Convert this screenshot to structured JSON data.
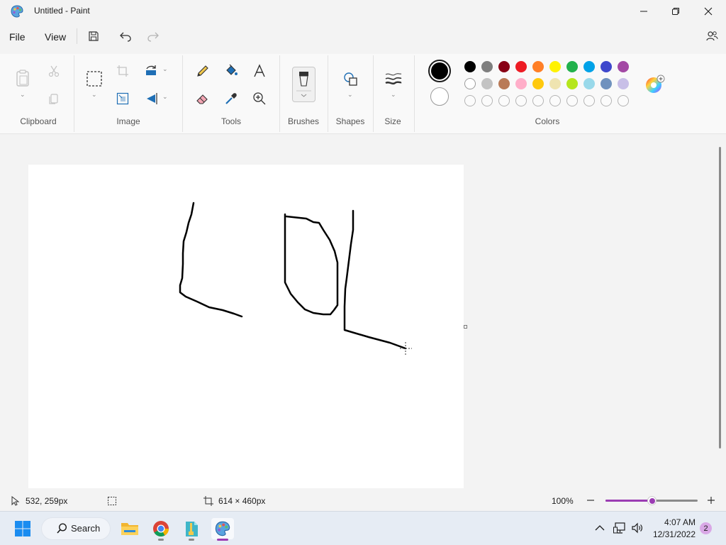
{
  "window": {
    "title": "Untitled - Paint"
  },
  "menu": {
    "file": "File",
    "view": "View"
  },
  "ribbon": {
    "groups": {
      "clipboard": "Clipboard",
      "image": "Image",
      "tools": "Tools",
      "brushes": "Brushes",
      "shapes": "Shapes",
      "size": "Size",
      "colors": "Colors"
    }
  },
  "colors": {
    "primary": "#000000",
    "secondary": "#ffffff",
    "palette_row1": [
      "#000000",
      "#7f7f7f",
      "#880015",
      "#ed1c24",
      "#ff7f27",
      "#fff200",
      "#22b14c",
      "#00a2e8",
      "#3f48cc",
      "#a349a4"
    ],
    "palette_row2": [
      "#ffffff",
      "#c3c3c3",
      "#b97a57",
      "#ffaec9",
      "#ffc90e",
      "#efe4b0",
      "#b5e61d",
      "#99d9ea",
      "#7092be",
      "#c8bfe7"
    ],
    "accent": "#9b3cb3"
  },
  "status": {
    "cursor_pos": "532, 259px",
    "canvas_size": "614 × 460px",
    "zoom": "100%",
    "zoom_level": 0.5
  },
  "taskbar": {
    "search": "Search",
    "time": "4:07 AM",
    "date": "12/31/2022",
    "notifications": "2"
  }
}
